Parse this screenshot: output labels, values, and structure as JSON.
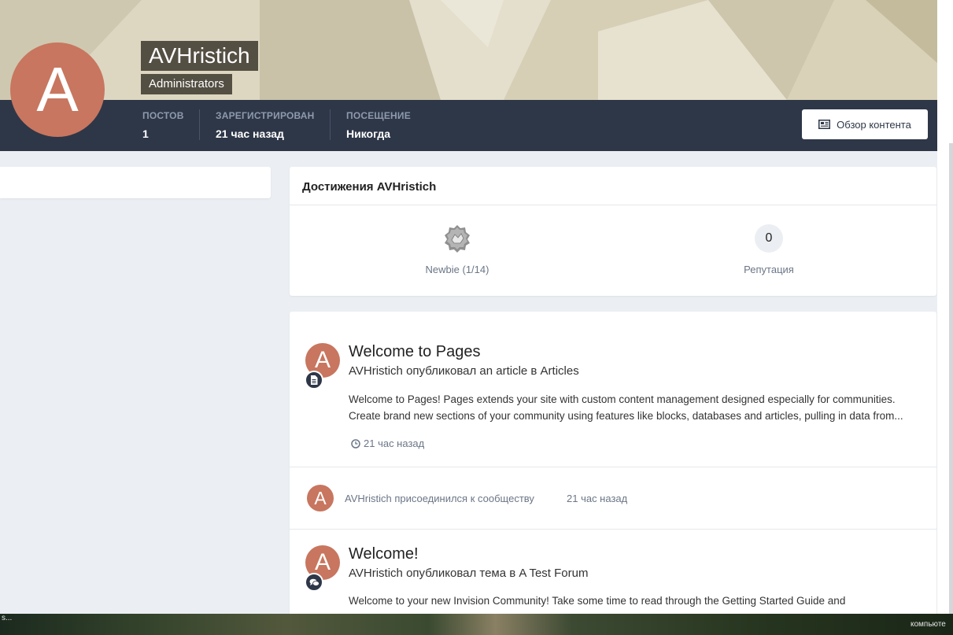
{
  "profile": {
    "username": "AVHristich",
    "group": "Administrators",
    "avatar_letter": "A",
    "avatar_color": "#c8765f"
  },
  "stats": [
    {
      "label": "ПОСТОВ",
      "value": "1"
    },
    {
      "label": "ЗАРЕГИСТРИРОВАН",
      "value": "21 час назад"
    },
    {
      "label": "ПОСЕЩЕНИЕ",
      "value": "Никогда"
    }
  ],
  "header": {
    "content_button_label": "Обзор контента",
    "bar_color": "#2e3748"
  },
  "achievements": {
    "title": "Достижения AVHristich",
    "rank_label": "Newbie (1/14)",
    "reputation_value": "0",
    "reputation_label": "Репутация"
  },
  "activity": [
    {
      "title": "Welcome to Pages",
      "meta": "AVHristich опубликовал an article в Articles",
      "snippet_line1": "Welcome to Pages! Pages extends your site with custom content management designed especially for communities.",
      "snippet_line2": "Create brand new sections of your community using features like blocks, databases and articles, pulling in data from...",
      "time": "21 час назад",
      "type_icon": "document-icon"
    },
    {
      "joined_text": "AVHristich присоединился к сообществу",
      "time": "21 час назад"
    },
    {
      "title": "Welcome!",
      "meta": "AVHristich опубликовал тема в A Test Forum",
      "snippet_line1": "Welcome to your new Invision Community! Take some time to read through the Getting Started Guide and",
      "type_icon": "comments-icon"
    }
  ],
  "taskbar": {
    "left_text": "s...",
    "right_text": "компьюте"
  }
}
